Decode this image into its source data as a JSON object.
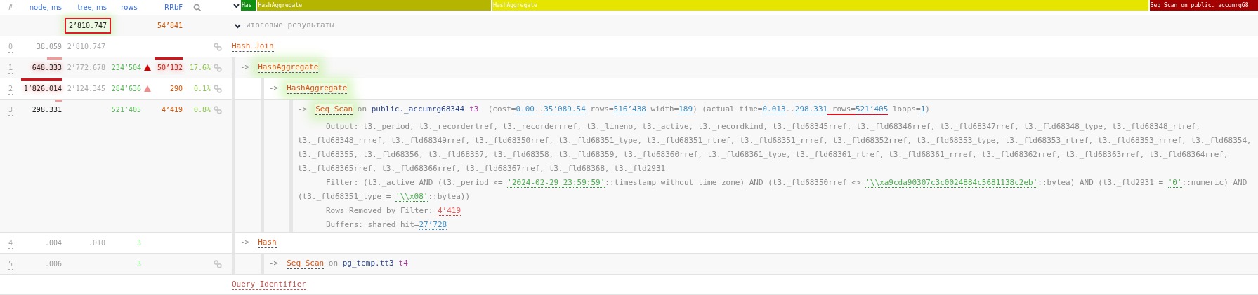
{
  "timeline": {
    "expanded": true,
    "segments": [
      {
        "label": "Has",
        "color": "#109010"
      },
      {
        "label": "HashAggregate",
        "color": "#b5b500"
      },
      {
        "label": "HashAggregate",
        "color": "#e5e500"
      },
      {
        "label": "Seq Scan on public._accumrg68",
        "color": "#a50000"
      }
    ]
  },
  "table": {
    "columns": [
      "#",
      "node, ms",
      "tree, ms",
      "rows",
      "RRbF"
    ],
    "summary": {
      "tree": "2’810.747",
      "tree_boxed": true,
      "rrbf": "54’841"
    },
    "rows": [
      {
        "index": "0",
        "node": {
          "text": "38.059",
          "bar": false
        },
        "tree": "2’810.747",
        "linked": true
      },
      {
        "index": "1",
        "node": {
          "text": "648.333",
          "bar": true
        },
        "tree": "2’772.678",
        "rows": "234’504",
        "warning": {
          "color": "#d40000"
        },
        "rrbf": {
          "text": "50’132",
          "bar": true
        },
        "percent": "17.6%",
        "linked": true
      },
      {
        "index": "2",
        "node": {
          "text": "1’826.014",
          "bar": true
        },
        "tree": "2’124.345",
        "rows": "284’636",
        "warning": {
          "color": "#f08c8c"
        },
        "rrbf": {
          "text": "290",
          "bar": false
        },
        "percent": "0.1%",
        "linked": true
      },
      {
        "index": "3",
        "node": {
          "text": "298.331",
          "bar": true
        },
        "rows": "521’405",
        "rrbf": {
          "text": "4’419",
          "bar": false
        },
        "percent": "0.8%",
        "linked": true
      },
      {
        "index": "4",
        "node": {
          "text": ".004",
          "bar": false
        },
        "tree": ".010",
        "rows": "3",
        "linked": false
      },
      {
        "index": "5",
        "node": {
          "text": ".006",
          "bar": false
        },
        "rows": "3",
        "linked": true
      }
    ]
  },
  "summary_row": {
    "expanded": true,
    "label": "итоговые результаты"
  },
  "plan": {
    "label": "Hash Join",
    "highlighted": false,
    "children": [
      {
        "arrow": "->",
        "label": "HashAggregate",
        "highlighted": true,
        "children": [
          {
            "arrow": "->",
            "label": "HashAggregate",
            "highlighted": true,
            "children": [
              {
                "arrow": "->",
                "label": "Seq Scan",
                "connector": "on",
                "relation": "public._accumrg68344",
                "alias": "t3",
                "highlighted": true,
                "extra": [
                  {
                    "kind": "plain",
                    "text": "  (cost="
                  },
                  {
                    "kind": "number",
                    "text": "0.00"
                  },
                  {
                    "kind": "plain",
                    "text": ".."
                  },
                  {
                    "kind": "number",
                    "text": "35’089.54"
                  },
                  {
                    "kind": "plain",
                    "text": " rows="
                  },
                  {
                    "kind": "number",
                    "text": "516’438"
                  },
                  {
                    "kind": "plain",
                    "text": " width="
                  },
                  {
                    "kind": "number",
                    "text": "189"
                  },
                  {
                    "kind": "plain",
                    "text": ") (actual time="
                  },
                  {
                    "kind": "number",
                    "text": "0.013"
                  },
                  {
                    "kind": "plain",
                    "text": ".."
                  },
                  {
                    "kind": "number",
                    "text": "298.331"
                  },
                  {
                    "kind": "flagged",
                    "parts": [
                      {
                        "kind": "plain",
                        "text": " rows="
                      },
                      {
                        "kind": "number",
                        "text": "521’405"
                      }
                    ]
                  },
                  {
                    "kind": "plain",
                    "text": " loops="
                  },
                  {
                    "kind": "number",
                    "text": "1"
                  },
                  {
                    "kind": "plain",
                    "text": ")"
                  }
                ],
                "details": [
                  [
                    {
                      "kind": "plain",
                      "text": "Output: t3._period, t3._recordertref, t3._recorderrref, t3._lineno, t3._active, t3._recordkind, t3._fld68345rref, t3._fld68346rref, t3._fld68347rref, t3._fld68348_type, t3._fld68348_rtref, t3._fld68348_rrref, t3._fld68349rref, t3._fld68350rref, t3._fld68351_type, t3._fld68351_rtref, t3._fld68351_rrref, t3._fld68352rref, t3._fld68353_type, t3._fld68353_rtref, t3._fld68353_rrref, t3._fld68354, t3._fld68355, t3._fld68356, t3._fld68357, t3._fld68358, t3._fld68359, t3._fld68360rref, t3._fld68361_type, t3._fld68361_rtref, t3._fld68361_rrref, t3._fld68362rref, t3._fld68363rref, t3._fld68364rref, t3._fld68365rref, t3._fld68366rref, t3._fld68367rref, t3._fld68368, t3._fld2931"
                    }
                  ],
                  [
                    {
                      "kind": "plain",
                      "text": "Filter: (t3._active AND (t3._period <= "
                    },
                    {
                      "kind": "literal",
                      "text": "'2024-02-29 23:59:59'"
                    },
                    {
                      "kind": "plain",
                      "text": "::timestamp without time zone) AND (t3._fld68350rref <> "
                    },
                    {
                      "kind": "literal",
                      "text": "'\\\\xa9cda90307c3c0024884c5681138c2eb'"
                    },
                    {
                      "kind": "plain",
                      "text": "::bytea) AND (t3._fld2931 = "
                    },
                    {
                      "kind": "literal",
                      "text": "'0'"
                    },
                    {
                      "kind": "plain",
                      "text": "::numeric) AND (t3._fld68351_type = "
                    },
                    {
                      "kind": "literal",
                      "text": "'\\\\x08'"
                    },
                    {
                      "kind": "plain",
                      "text": "::bytea))"
                    }
                  ],
                  [
                    {
                      "kind": "plain",
                      "text": "Rows Removed by Filter: "
                    },
                    {
                      "kind": "warn",
                      "text": "4’419"
                    }
                  ],
                  [
                    {
                      "kind": "plain",
                      "text": "Buffers: shared hit="
                    },
                    {
                      "kind": "number",
                      "text": "27’728"
                    }
                  ]
                ]
              }
            ]
          }
        ]
      },
      {
        "arrow": "->",
        "label": "Hash",
        "highlighted": false,
        "children": [
          {
            "arrow": "->",
            "label": "Seq Scan",
            "connector": "on",
            "relation": "pg_temp.tt3",
            "alias": "t4",
            "highlighted": false
          }
        ]
      }
    ]
  },
  "footer": {
    "label": "Query Identifier"
  }
}
